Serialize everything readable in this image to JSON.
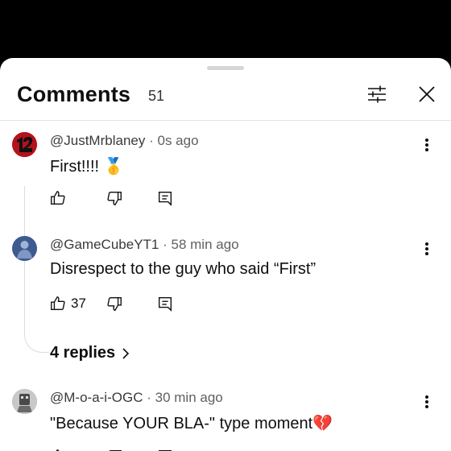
{
  "panel": {
    "title": "Comments",
    "count": "51"
  },
  "comments": [
    {
      "author": "@JustMrblaney",
      "time": "0s ago",
      "text": "First!!!! 🥇",
      "likes": ""
    },
    {
      "author": "@GameCubeYT1",
      "time": "58 min ago",
      "text": "Disrespect to the guy who said “First”",
      "likes": "37",
      "replies": "4 replies"
    },
    {
      "author": "@M-o-a-i-OGC",
      "time": "30 min ago",
      "text": "\"Because YOUR BLA-\" type moment💔",
      "likes": ""
    }
  ],
  "separator": "·",
  "colors": {
    "background": "#000000",
    "sheet": "#ffffff",
    "avatar1": "#b5121b",
    "avatar2": "#5b77a8",
    "avatar3": "#9a9a9a"
  },
  "icons": [
    "filter-icon",
    "close-icon",
    "thumb-up-icon",
    "thumb-down-icon",
    "reply-icon",
    "more-vert-icon",
    "chevron-right-icon"
  ]
}
